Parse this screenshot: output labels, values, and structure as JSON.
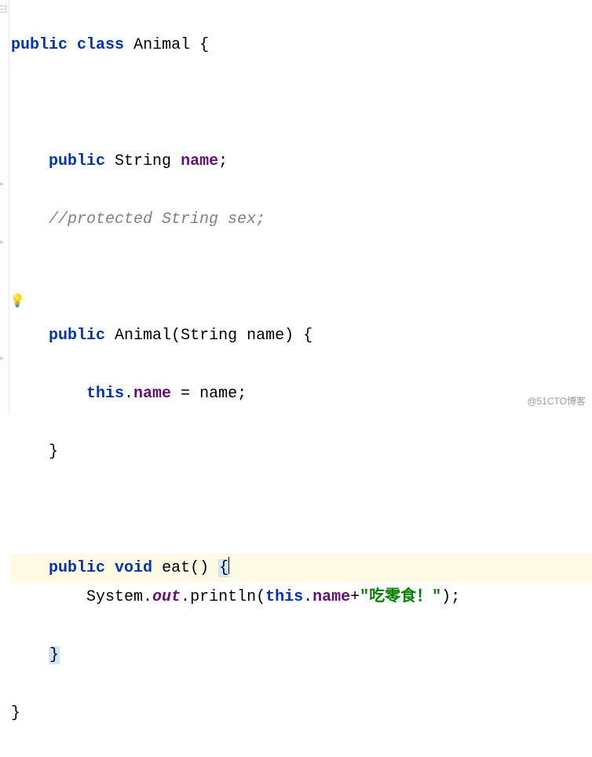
{
  "code": {
    "l1": {
      "kw1": "public",
      "kw2": "class",
      "name": "Animal",
      "brace": "{"
    },
    "l2": "",
    "l3": {
      "kw": "public",
      "type": "String",
      "field": "name",
      "end": ";"
    },
    "l4": {
      "comment": "//protected String sex;"
    },
    "l5": "",
    "l6": {
      "kw": "public",
      "ctor": "Animal",
      "params_open": "(",
      "ptype": "String",
      "pname": "name",
      "params_close": ")",
      "brace": "{"
    },
    "l7": {
      "kw": "this",
      "dot": ".",
      "field": "name",
      "eq": " = ",
      "rhs": "name",
      "end": ";"
    },
    "l8": {
      "brace": "}"
    },
    "l9": "",
    "l10": {
      "kw1": "public",
      "kw2": "void",
      "method": "eat",
      "parens": "()",
      "brace": "{"
    },
    "l11": {
      "cls": "System",
      "dot1": ".",
      "out": "out",
      "dot2": ".",
      "fn": "println",
      "open": "(",
      "kw": "this",
      "dot3": ".",
      "field": "name",
      "plus": "+",
      "str": "\"吃零食！\"",
      "close": ")",
      "end": ";"
    },
    "l12": {
      "brace": "}"
    },
    "l13": {
      "brace": "}"
    }
  },
  "watermark": "@51CTO博客"
}
